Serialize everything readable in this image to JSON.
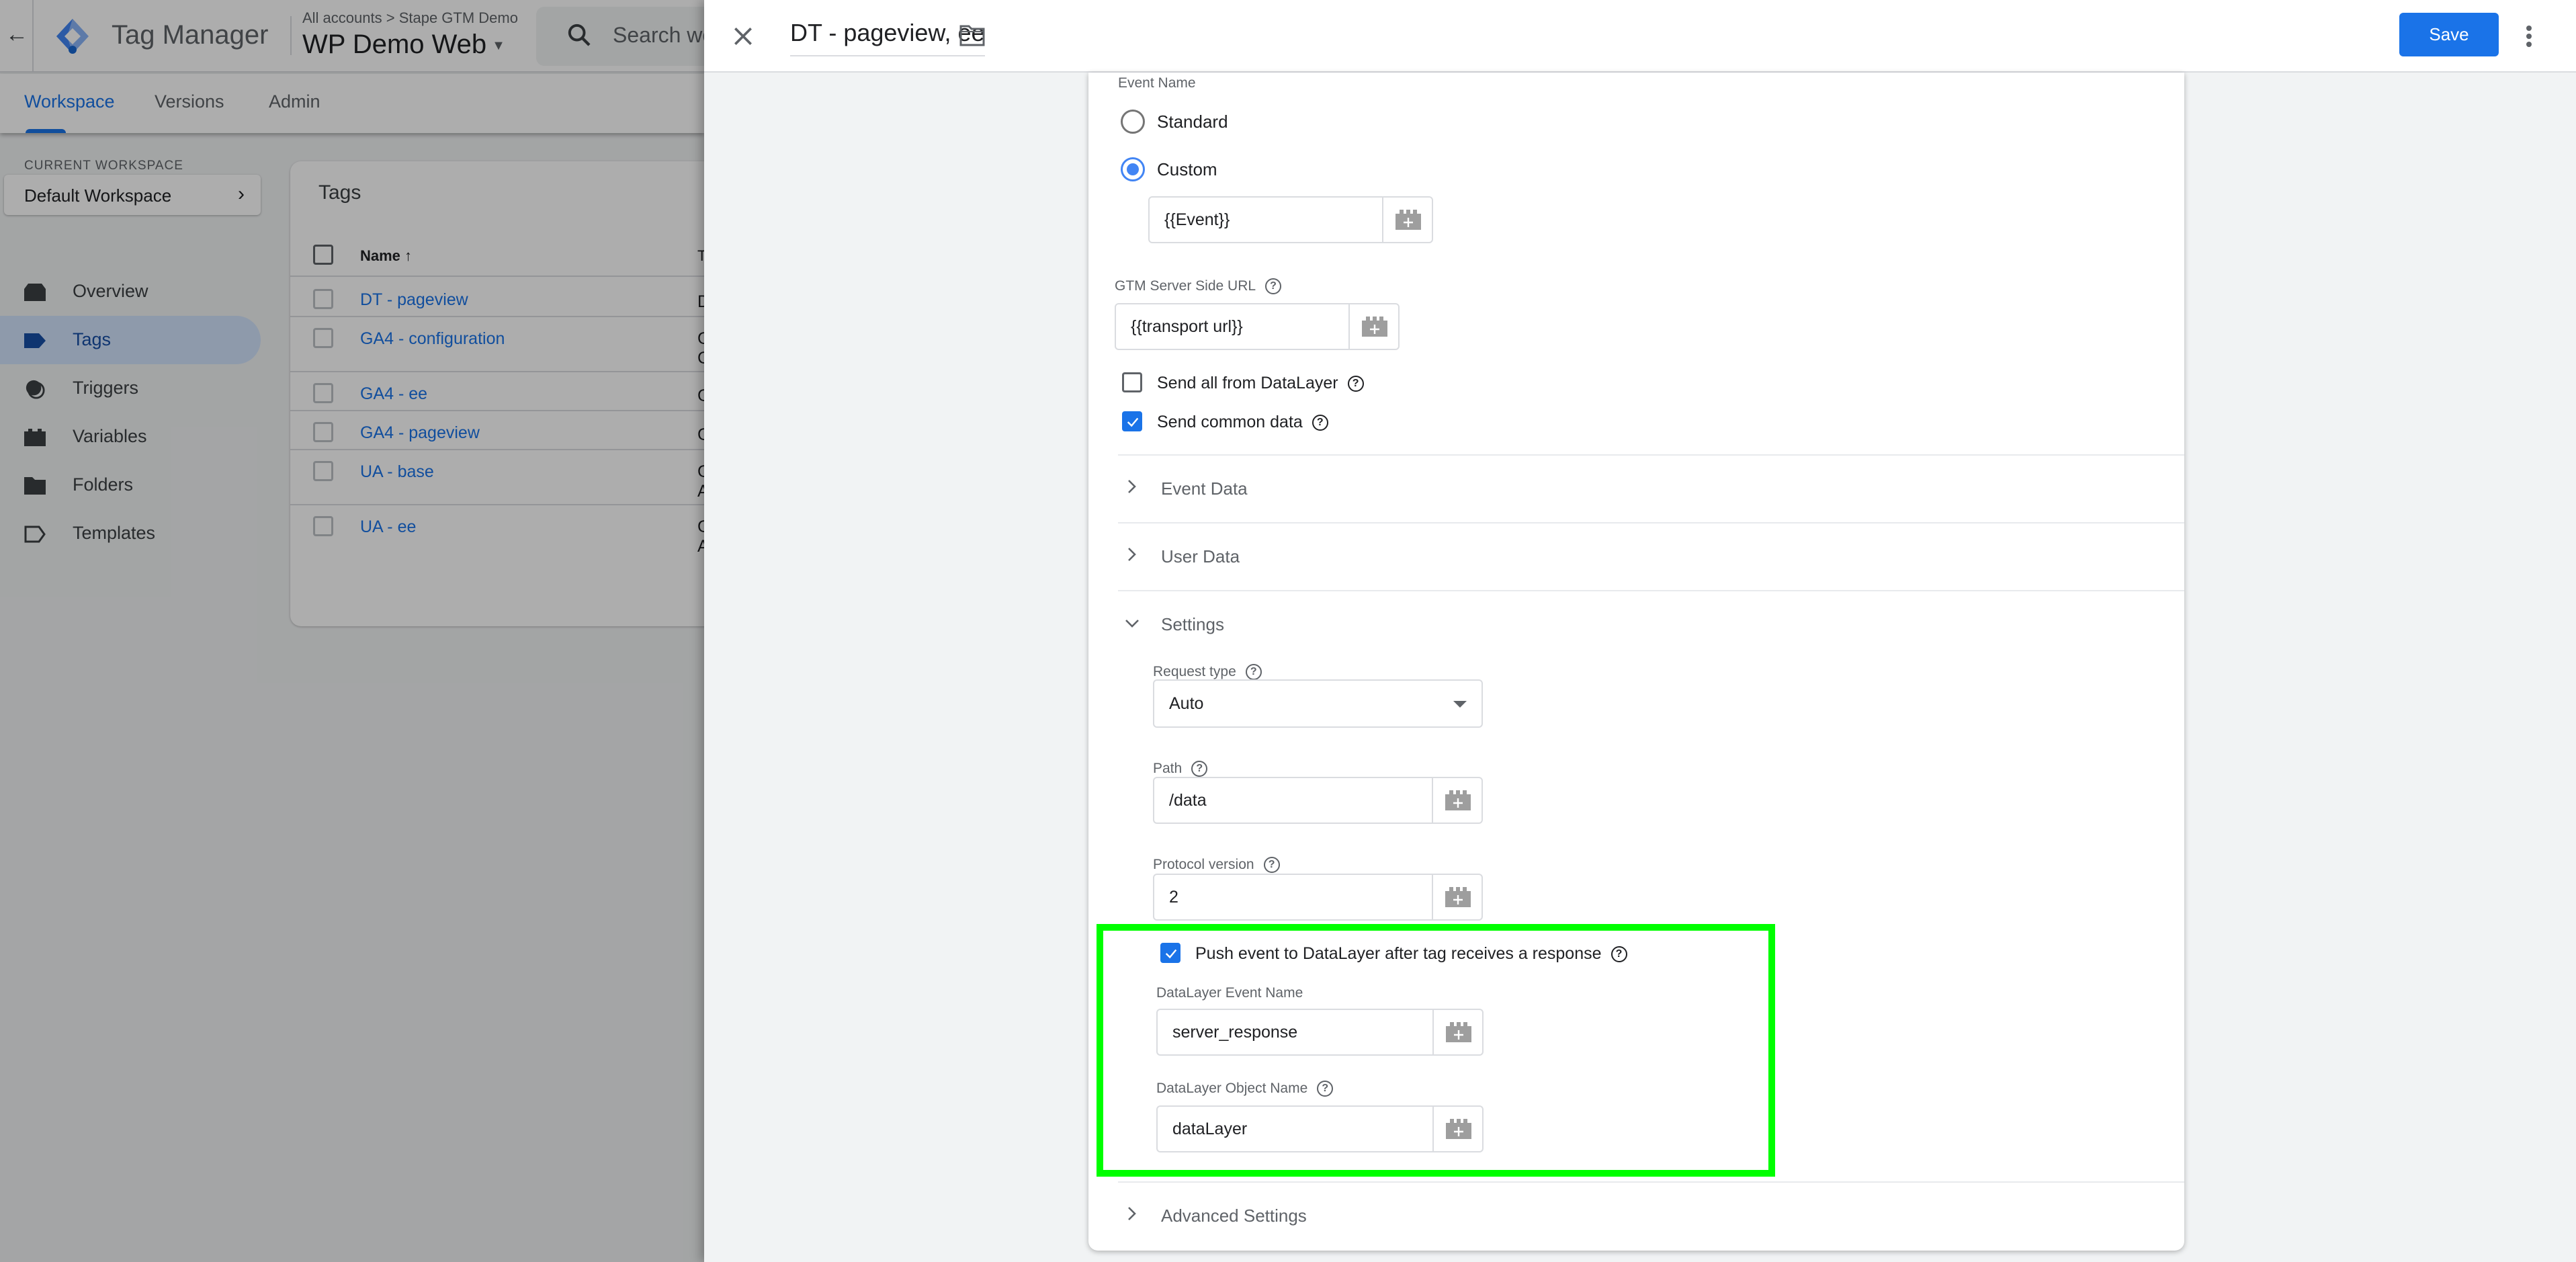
{
  "app": {
    "product_name": "Tag Manager",
    "breadcrumb": "All accounts > Stape GTM Demo",
    "container_name": "WP Demo Web",
    "search_placeholder": "Search wo",
    "tabs": [
      {
        "label": "Workspace",
        "active": true
      },
      {
        "label": "Versions",
        "active": false
      },
      {
        "label": "Admin",
        "active": false
      }
    ],
    "current_workspace_label": "CURRENT WORKSPACE",
    "current_workspace": "Default Workspace",
    "nav": [
      {
        "label": "Overview",
        "icon": "overview-icon",
        "active": false
      },
      {
        "label": "Tags",
        "icon": "tag-icon",
        "active": true
      },
      {
        "label": "Triggers",
        "icon": "trigger-icon",
        "active": false
      },
      {
        "label": "Variables",
        "icon": "variable-icon",
        "active": false
      },
      {
        "label": "Folders",
        "icon": "folder-icon",
        "active": false
      },
      {
        "label": "Templates",
        "icon": "template-icon",
        "active": false
      }
    ],
    "tags_table": {
      "title": "Tags",
      "col_name": "Name",
      "col_type_partial": "T",
      "rows": [
        {
          "name": "DT - pageview",
          "type_partial": "D"
        },
        {
          "name": "GA4 - configuration",
          "type_partial": "G\nC"
        },
        {
          "name": "GA4 - ee",
          "type_partial": "G"
        },
        {
          "name": "GA4 - pageview",
          "type_partial": "G"
        },
        {
          "name": "UA - base",
          "type_partial": "G\nA"
        },
        {
          "name": "UA - ee",
          "type_partial": "G\nA"
        }
      ]
    }
  },
  "panel": {
    "title": "DT - pageview, ee",
    "save_label": "Save",
    "event_name": {
      "label": "Event Name",
      "options": [
        {
          "label": "Standard",
          "checked": false
        },
        {
          "label": "Custom",
          "checked": true
        }
      ],
      "custom_value": "{{Event}}"
    },
    "server_url": {
      "label": "GTM Server Side URL",
      "value": "{{transport url}}"
    },
    "send_all_from_datalayer": {
      "label": "Send all from DataLayer",
      "checked": false
    },
    "send_common_data": {
      "label": "Send common data",
      "checked": true
    },
    "sections": {
      "event_data": "Event Data",
      "user_data": "User Data",
      "settings": "Settings",
      "advanced_settings": "Advanced Settings"
    },
    "settings": {
      "request_type": {
        "label": "Request type",
        "value": "Auto"
      },
      "path": {
        "label": "Path",
        "value": "/data"
      },
      "protocol_version": {
        "label": "Protocol version",
        "value": "2"
      },
      "push_event": {
        "label": "Push event to DataLayer after tag receives a response",
        "checked": true
      },
      "datalayer_event_name": {
        "label": "DataLayer Event Name",
        "value": "server_response"
      },
      "datalayer_object_name": {
        "label": "DataLayer Object Name",
        "value": "dataLayer"
      }
    },
    "colors": {
      "accent": "#1a73e8",
      "highlight": "#00ff00"
    }
  }
}
